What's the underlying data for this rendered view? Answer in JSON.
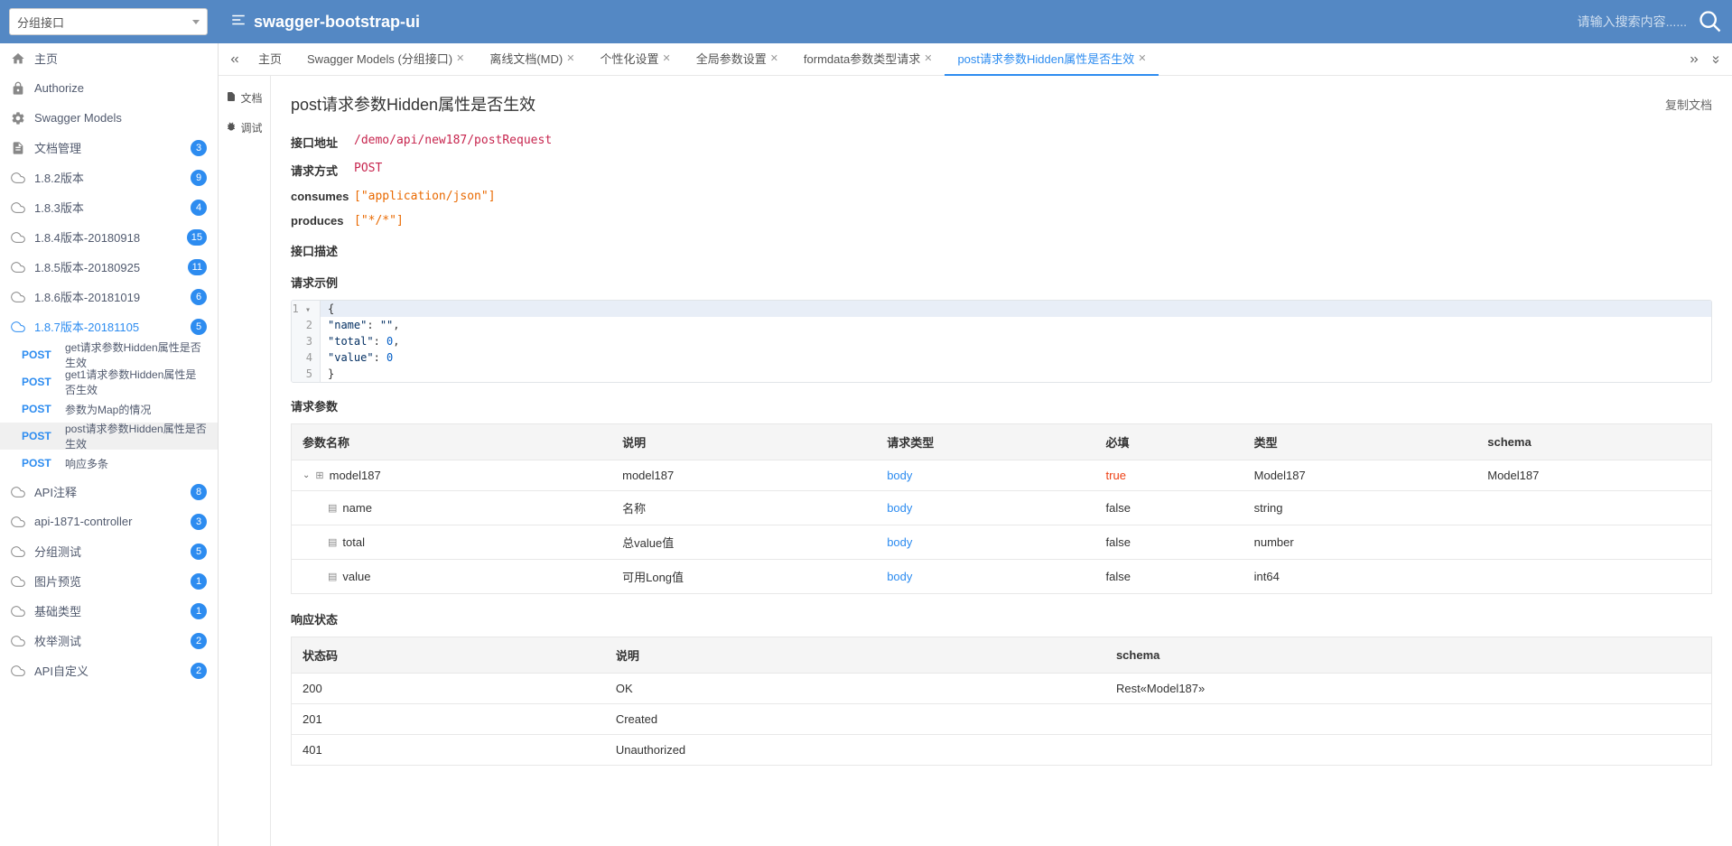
{
  "header": {
    "group_select": "分组接口",
    "title": "swagger-bootstrap-ui",
    "search_placeholder": "请输入搜索内容......"
  },
  "sidebar": {
    "home": "主页",
    "authorize": "Authorize",
    "swagger_models": "Swagger Models",
    "doc_manage": {
      "label": "文档管理",
      "badge": "3"
    },
    "versions": [
      {
        "label": "1.8.2版本",
        "badge": "9"
      },
      {
        "label": "1.8.3版本",
        "badge": "4"
      },
      {
        "label": "1.8.4版本-20180918",
        "badge": "15"
      },
      {
        "label": "1.8.5版本-20180925",
        "badge": "11"
      },
      {
        "label": "1.8.6版本-20181019",
        "badge": "6"
      },
      {
        "label": "1.8.7版本-20181105",
        "badge": "5",
        "highlight": true
      }
    ],
    "endpoints": [
      {
        "method": "POST",
        "label": "get请求参数Hidden属性是否生效"
      },
      {
        "method": "POST",
        "label": "get1请求参数Hidden属性是否生效"
      },
      {
        "method": "POST",
        "label": "参数为Map的情况"
      },
      {
        "method": "POST",
        "label": "post请求参数Hidden属性是否生效",
        "active": true
      },
      {
        "method": "POST",
        "label": "响应多条"
      }
    ],
    "bottom_items": [
      {
        "label": "API注释",
        "badge": "8"
      },
      {
        "label": "api-1871-controller",
        "badge": "3"
      },
      {
        "label": "分组测试",
        "badge": "5"
      },
      {
        "label": "图片预览",
        "badge": "1"
      },
      {
        "label": "基础类型",
        "badge": "1"
      },
      {
        "label": "枚举测试",
        "badge": "2"
      },
      {
        "label": "API自定义",
        "badge": "2"
      }
    ]
  },
  "tabs": [
    {
      "label": "主页",
      "closable": false
    },
    {
      "label": "Swagger Models (分组接口)",
      "closable": true
    },
    {
      "label": "离线文档(MD)",
      "closable": true
    },
    {
      "label": "个性化设置",
      "closable": true
    },
    {
      "label": "全局参数设置",
      "closable": true
    },
    {
      "label": "formdata参数类型请求",
      "closable": true
    },
    {
      "label": "post请求参数Hidden属性是否生效",
      "closable": true,
      "active": true
    }
  ],
  "panel_tabs": {
    "doc": "文档",
    "debug": "调试"
  },
  "doc": {
    "title": "post请求参数Hidden属性是否生效",
    "copy": "复制文档",
    "api_url_label": "接口地址",
    "api_url": "/demo/api/new187/postRequest",
    "method_label": "请求方式",
    "method": "POST",
    "consumes_label": "consumes",
    "consumes": "[\"application/json\"]",
    "produces_label": "produces",
    "produces": "[\"*/*\"]",
    "desc_label": "接口描述",
    "example_label": "请求示例",
    "params_label": "请求参数",
    "response_status_label": "响应状态"
  },
  "code_lines": [
    "{",
    "    \"name\": \"\",",
    "    \"total\": 0,",
    "    \"value\": 0",
    "}"
  ],
  "param_headers": {
    "name": "参数名称",
    "desc": "说明",
    "req_type": "请求类型",
    "required": "必填",
    "type": "类型",
    "schema": "schema"
  },
  "params": [
    {
      "name": "model187",
      "desc": "model187",
      "req": "body",
      "required": "true",
      "required_red": true,
      "type": "Model187",
      "schema": "Model187",
      "expandable": true
    },
    {
      "name": "name",
      "desc": "名称",
      "req": "body",
      "required": "false",
      "type": "string",
      "schema": "",
      "indent": true
    },
    {
      "name": "total",
      "desc": "总value值",
      "req": "body",
      "required": "false",
      "type": "number",
      "schema": "",
      "indent": true
    },
    {
      "name": "value",
      "desc": "可用Long值",
      "req": "body",
      "required": "false",
      "type": "int64",
      "schema": "",
      "indent": true
    }
  ],
  "status_headers": {
    "code": "状态码",
    "desc": "说明",
    "schema": "schema"
  },
  "statuses": [
    {
      "code": "200",
      "desc": "OK",
      "schema": "Rest«Model187»"
    },
    {
      "code": "201",
      "desc": "Created",
      "schema": ""
    },
    {
      "code": "401",
      "desc": "Unauthorized",
      "schema": ""
    }
  ]
}
